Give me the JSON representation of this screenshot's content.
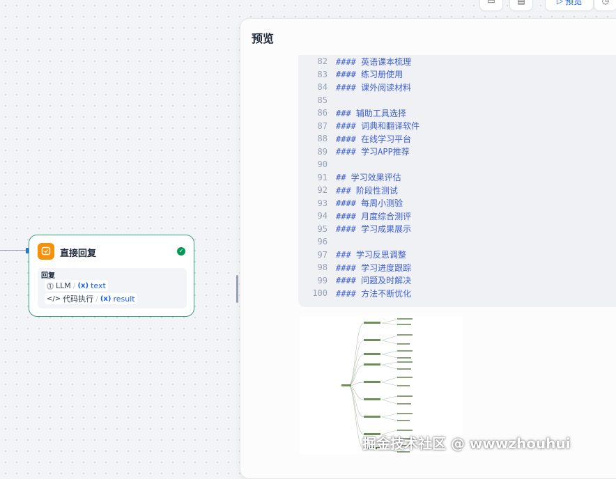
{
  "toolbar": {
    "preview_label": "预览"
  },
  "node": {
    "title": "直接回复",
    "body_label": "回复",
    "vars": [
      {
        "source": "LLM",
        "var": "text"
      },
      {
        "source": "代码执行",
        "var": "result"
      }
    ],
    "var_symbol": "(x)",
    "separator": "/"
  },
  "panel": {
    "title": "预览",
    "code_lines": [
      {
        "n": "82",
        "text": "#### 英语课本梳理"
      },
      {
        "n": "83",
        "text": "#### 练习册使用"
      },
      {
        "n": "84",
        "text": "#### 课外阅读材料"
      },
      {
        "n": "85",
        "text": ""
      },
      {
        "n": "86",
        "text": "### 辅助工具选择"
      },
      {
        "n": "87",
        "text": "#### 词典和翻译软件"
      },
      {
        "n": "88",
        "text": "#### 在线学习平台"
      },
      {
        "n": "89",
        "text": "#### 学习APP推荐"
      },
      {
        "n": "90",
        "text": ""
      },
      {
        "n": "91",
        "text": "## 学习效果评估"
      },
      {
        "n": "92",
        "text": "### 阶段性测试"
      },
      {
        "n": "93",
        "text": "#### 每周小测验"
      },
      {
        "n": "94",
        "text": "#### 月度综合测评"
      },
      {
        "n": "95",
        "text": "#### 学习成果展示"
      },
      {
        "n": "96",
        "text": ""
      },
      {
        "n": "97",
        "text": "### 学习反思调整"
      },
      {
        "n": "98",
        "text": "#### 学习进度跟踪"
      },
      {
        "n": "99",
        "text": "#### 问题及时解决"
      },
      {
        "n": "100",
        "text": "#### 方法不断优化"
      }
    ]
  },
  "watermark": "掘金技术社区 @ wwwzhouhui",
  "colors": {
    "node_border": "#2ca172",
    "node_icon_bg": "#f79009",
    "accent": "#155eef",
    "code_text": "#3e5fcf",
    "success": "#039855"
  }
}
